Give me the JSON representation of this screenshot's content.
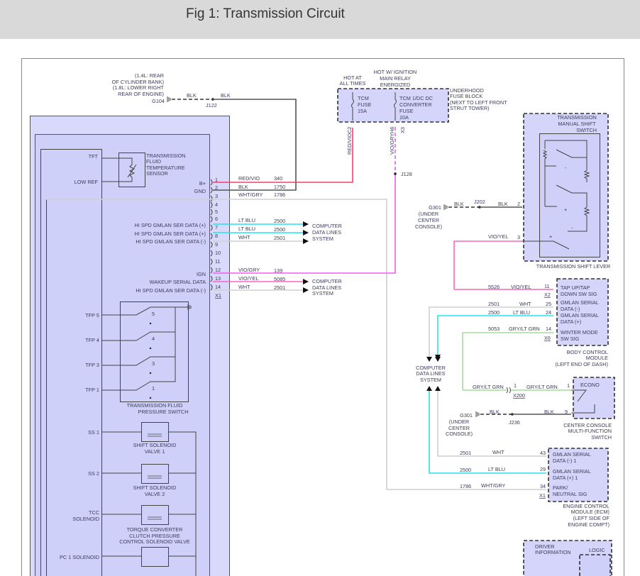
{
  "header": {
    "title": "Fig 1: Transmission Circuit"
  },
  "colors": {
    "red_vio": "#f0436a",
    "vio_gry": "#f25cf0",
    "lt_blu": "#22e3ee",
    "wht": "#cfcfcf",
    "gry_lt_grn": "#a4dd9c",
    "vio_yel": "#f566c8",
    "module_fill": "#d5d5fb"
  },
  "g104": {
    "note": [
      "(1.4L: REAR",
      "OF CYLINDER BANK)",
      "(1.8L: LOWER RIGHT",
      "REAR OF ENGINE)"
    ],
    "label": "G104",
    "wire1": "BLK",
    "junction": "J122",
    "wire2": "BLK"
  },
  "tft": {
    "pin1": "TFT",
    "pin2": "LOW REF",
    "name": [
      "TRANSMISSION",
      "FLUID",
      "TEMPERATURE",
      "SENSOR"
    ]
  },
  "tcm_pins": [
    {
      "num": "1",
      "label": "B+",
      "color": "RED/VIO",
      "circuit": "340"
    },
    {
      "num": "2",
      "label": "GND",
      "color": "BLK",
      "circuit": "1750"
    },
    {
      "num": "3",
      "label": "",
      "color": "WHT/GRY",
      "circuit": "1786"
    },
    {
      "num": "4"
    },
    {
      "num": "5"
    },
    {
      "num": "6",
      "label": "HI SPD GMLAN SER DATA (+)",
      "color": "LT BLU",
      "circuit": "2500"
    },
    {
      "num": "7",
      "label": "HI SPD GMLAN SER DATA (+)",
      "color": "LT BLU",
      "circuit": "2500"
    },
    {
      "num": "8",
      "label": "HI SPD GMLAN SER DATA (-)",
      "color": "WHT",
      "circuit": "2501"
    },
    {
      "num": "9"
    },
    {
      "num": "10"
    },
    {
      "num": "11"
    },
    {
      "num": "12",
      "label": "IGN",
      "color": "VIO/GRY",
      "circuit": "139"
    },
    {
      "num": "13",
      "label": "WAKEUP SERIAL DATA",
      "color": "VIO/YEL",
      "circuit": "5085"
    },
    {
      "num": "14",
      "label": "HI SPD GMLAN SER DATA (-)",
      "color": "WHT",
      "circuit": "2501"
    }
  ],
  "tcm_connector": "X1",
  "computer_data_lines": [
    "COMPUTER",
    "DATA LINES",
    "SYSTEM"
  ],
  "fuse_block": {
    "hot_all": [
      "HOT AT",
      "ALL TIMES"
    ],
    "hot_ign": [
      "HOT W/ IGNITION",
      "MAIN RELAY",
      "ENERGIZED"
    ],
    "fuse1": [
      "TCM",
      "FUSE",
      "15A"
    ],
    "fuse2": [
      "TCM 1/DC DC",
      "CONVERTER",
      "FUSE",
      "10A"
    ],
    "name": [
      "UNDERHOOD",
      "FUSE BLOCK",
      "(NEXT TO LEFT FRONT",
      "STRUT TOWER)"
    ],
    "c2": "C2",
    "red_vio": "RED/VIO",
    "h6": "H6",
    "vio_gry": "VIO/GRY",
    "x3": "X3",
    "j128": "J128"
  },
  "shift_switch": {
    "name": [
      "TRANSMISSION",
      "MANUAL SHIFT",
      "SWITCH"
    ],
    "lever": "TRANSMISSION SHIFT LEVER",
    "plus": "+",
    "minus": "-",
    "g301": "G301",
    "g301_note": [
      "(UNDER",
      "CENTER",
      "CONSOLE)"
    ],
    "blk1": "BLK",
    "j202": "J202",
    "blk2": "BLK",
    "pin2": "2",
    "vio_yel": "VIO/YEL",
    "pin3": "3"
  },
  "bcm": {
    "rows": [
      {
        "circuit": "5526",
        "color": "VIO/YEL",
        "pin": "11"
      },
      {
        "circuit": "2501",
        "color": "WHT",
        "pin": "25"
      },
      {
        "circuit": "2500",
        "color": "LT BLU",
        "pin": "24"
      },
      {
        "circuit": "5053",
        "color": "GRY/LT GRN",
        "pin": "14"
      }
    ],
    "x2": "X2",
    "x6": "X6",
    "labels": [
      "TAP UP/TAP",
      "DOWN SW SIG",
      "GMLAN SERIAL",
      "DATA (-)",
      "GMLAN SERIAL",
      "DATA (+)",
      "WINTER MODE",
      "SW SIG"
    ],
    "name": [
      "BODY CONTROL",
      "MODULE",
      "(LEFT END OF DASH)"
    ]
  },
  "console": {
    "wire1": "GRY/LT GRN",
    "pin_a": "1",
    "x200": "X200",
    "wire2": "GRY/LT GRN",
    "pin1": "1",
    "econo": "ECONO",
    "g301": "G301",
    "g301_note": [
      "(UNDER",
      "CENTER",
      "CONSOLE)"
    ],
    "blk1": "BLK",
    "j236": "J236",
    "blk2": "BLK",
    "pin9": "9",
    "name": [
      "CENTER CONSOLE",
      "MULTI-FUNCTION",
      "SWITCH"
    ]
  },
  "ecm": {
    "rows": [
      {
        "circuit": "2501",
        "color": "WHT",
        "pin": "43"
      },
      {
        "circuit": "2500",
        "color": "LT BLU",
        "pin": "29"
      },
      {
        "circuit": "1786",
        "color": "WHT/GRY",
        "pin": "34"
      }
    ],
    "x1": "X1",
    "labels": [
      "GMLAN SERIAL",
      "DATA (-) 1",
      "GMLAN SERIAL",
      "DATA (+) 1",
      "PARK/",
      "NEUTRAL SIG"
    ],
    "name": [
      "ENGINE CONTROL",
      "MODULE (ECM)",
      "(LEFT SIDE OF",
      "ENGINE COMPT)"
    ]
  },
  "dic": {
    "name": [
      "DRIVER",
      "INFORMATION"
    ],
    "logic": "LOGIC"
  },
  "tfp": {
    "pins": [
      "TFP 5",
      "TFP 4",
      "TFP 3",
      "TFP 1"
    ],
    "positions": [
      "5",
      "4",
      "3",
      "1"
    ],
    "name": [
      "TRANSMISSION FLUID",
      "PRESSURE SWITCH"
    ]
  },
  "solenoids": [
    {
      "pin": [
        "SS 1"
      ],
      "name": [
        "SHIFT SOLENOID",
        "VALVE 1"
      ]
    },
    {
      "pin": [
        "SS 2"
      ],
      "name": [
        "SHIFT SOLENOID",
        "VALVE 2"
      ]
    },
    {
      "pin": [
        "TCC",
        "SOLENOID"
      ],
      "name": [
        "TORQUE CONVERTER",
        "CLUTCH PRESSURE",
        "CONTROL SOLENOID VALVE"
      ]
    },
    {
      "pin": [
        "PC 1 SOLENOID"
      ],
      "name": []
    }
  ]
}
